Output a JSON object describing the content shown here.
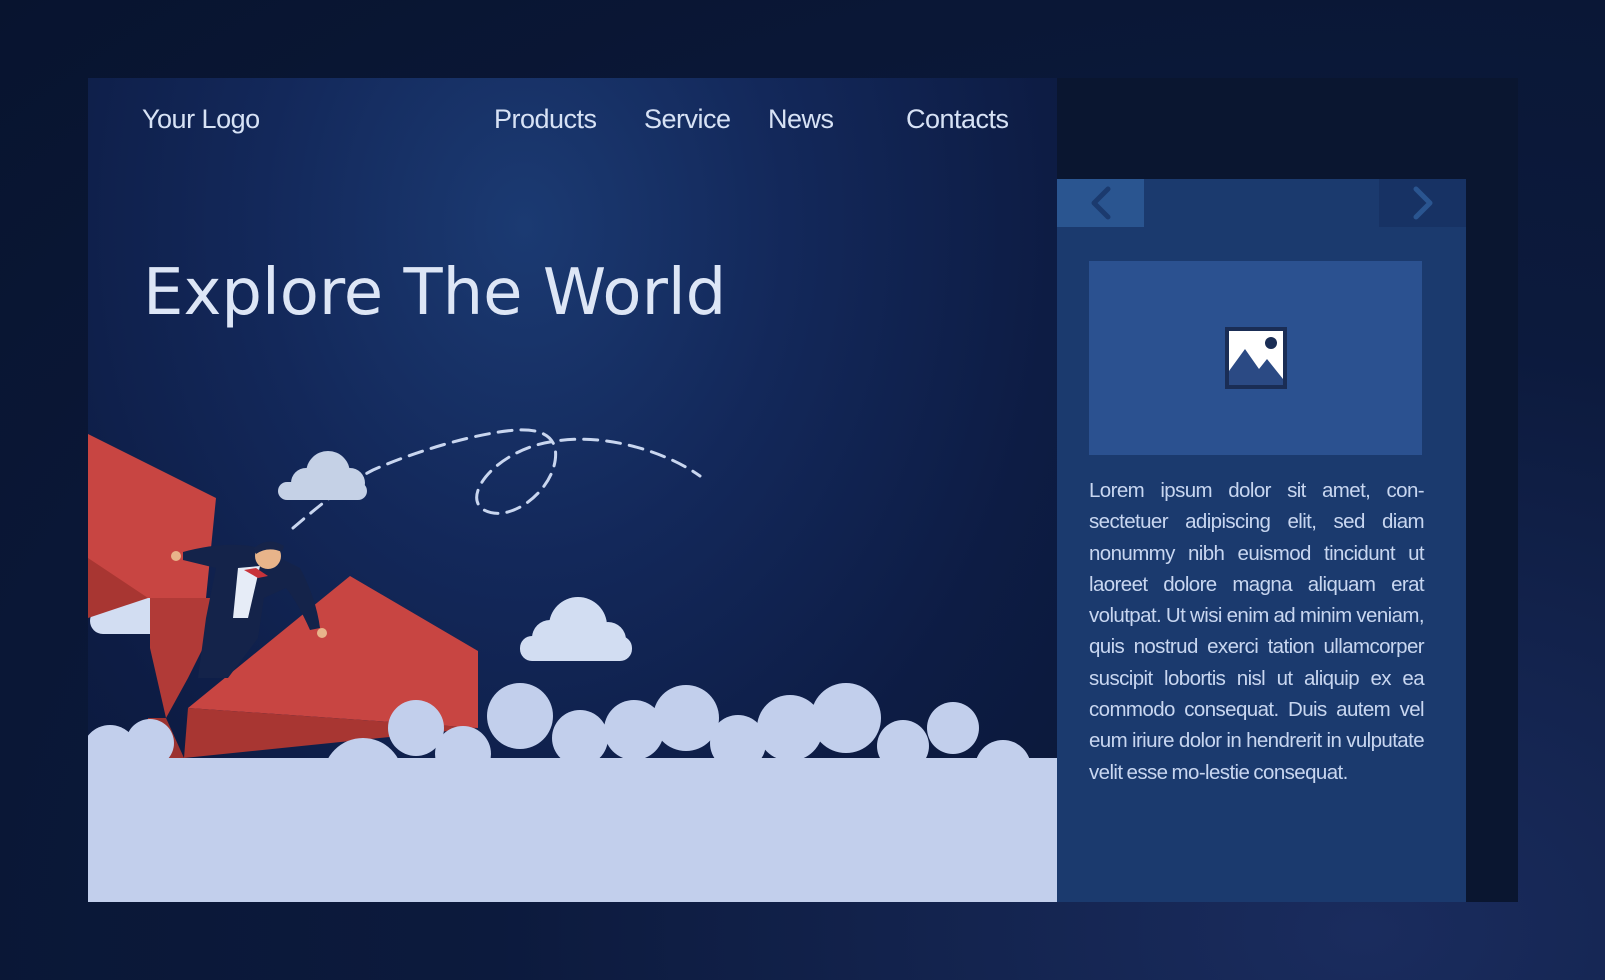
{
  "header": {
    "logo": "Your Logo",
    "nav": [
      {
        "label": "Products"
      },
      {
        "label": "Service"
      },
      {
        "label": "News"
      },
      {
        "label": "Contacts"
      }
    ]
  },
  "hero": {
    "title": "Explore The World"
  },
  "panel": {
    "prev_icon": "chevron-left-icon",
    "next_icon": "chevron-right-icon",
    "image_icon": "image-placeholder-icon",
    "body": "Lorem ipsum dolor sit amet, con-sectetuer adipiscing elit, sed diam nonummy nibh euismod tincidunt ut laoreet dolore magna aliquam erat volutpat. Ut wisi enim ad minim veniam, quis nostrud exerci tation ullamcorper suscipit lobortis nisl ut aliquip ex ea commodo consequat. Duis autem vel eum iriure dolor in hendrerit in vulputate velit esse mo-lestie consequat."
  },
  "colors": {
    "background": "#0a1736",
    "hero_bg": "#13285a",
    "panel_bg": "#1b3a6e",
    "text": "#d7e2f5",
    "plane_red": "#c84542",
    "cloud": "#c2cfec"
  }
}
